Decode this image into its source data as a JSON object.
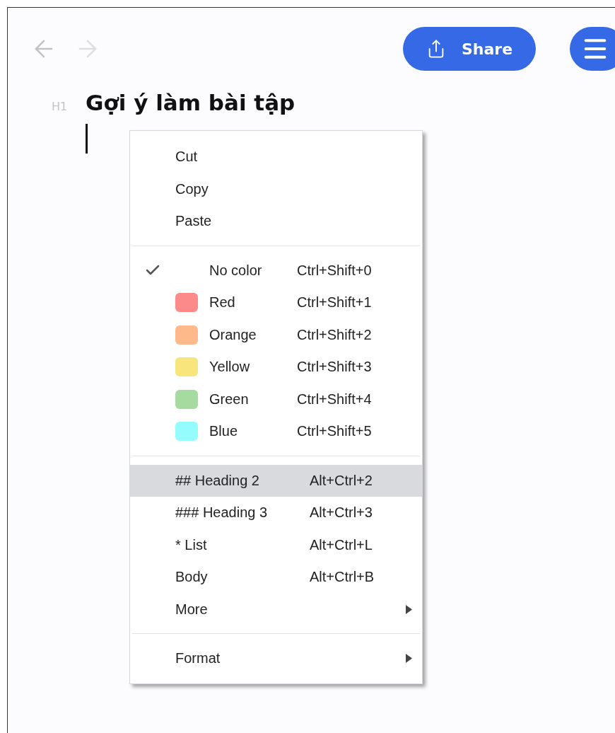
{
  "toolbar": {
    "share_label": "Share"
  },
  "document": {
    "heading_level": "H1",
    "title": "Gợi ý làm bài tập"
  },
  "context_menu": {
    "groups": [
      [
        {
          "kind": "action",
          "label": "Cut",
          "selected": false
        },
        {
          "kind": "action",
          "label": "Copy",
          "selected": false
        },
        {
          "kind": "action",
          "label": "Paste",
          "selected": false
        }
      ],
      [
        {
          "kind": "color",
          "label": "No color",
          "shortcut": "Ctrl+Shift+0",
          "checked": true,
          "selected": false
        },
        {
          "kind": "color",
          "label": "Red",
          "shortcut": "Ctrl+Shift+1",
          "checked": false,
          "color": "#fd8a8a",
          "selected": false
        },
        {
          "kind": "color",
          "label": "Orange",
          "shortcut": "Ctrl+Shift+2",
          "checked": false,
          "color": "#fdb98a",
          "selected": false
        },
        {
          "kind": "color",
          "label": "Yellow",
          "shortcut": "Ctrl+Shift+3",
          "checked": false,
          "color": "#f8e57c",
          "selected": false
        },
        {
          "kind": "color",
          "label": "Green",
          "shortcut": "Ctrl+Shift+4",
          "checked": false,
          "color": "#a6dba0",
          "selected": false
        },
        {
          "kind": "color",
          "label": "Blue",
          "shortcut": "Ctrl+Shift+5",
          "checked": false,
          "color": "#94fcfc",
          "selected": false
        }
      ],
      [
        {
          "kind": "style",
          "label": "## Heading 2",
          "shortcut": "Alt+Ctrl+2",
          "selected": true
        },
        {
          "kind": "style",
          "label": "### Heading 3",
          "shortcut": "Alt+Ctrl+3",
          "selected": false
        },
        {
          "kind": "style",
          "label": "* List",
          "shortcut": "Alt+Ctrl+L",
          "selected": false
        },
        {
          "kind": "style",
          "label": "Body",
          "shortcut": "Alt+Ctrl+B",
          "selected": false
        },
        {
          "kind": "submenu",
          "label": "More",
          "selected": false
        }
      ],
      [
        {
          "kind": "submenu",
          "label": "Format",
          "selected": false
        }
      ]
    ]
  }
}
